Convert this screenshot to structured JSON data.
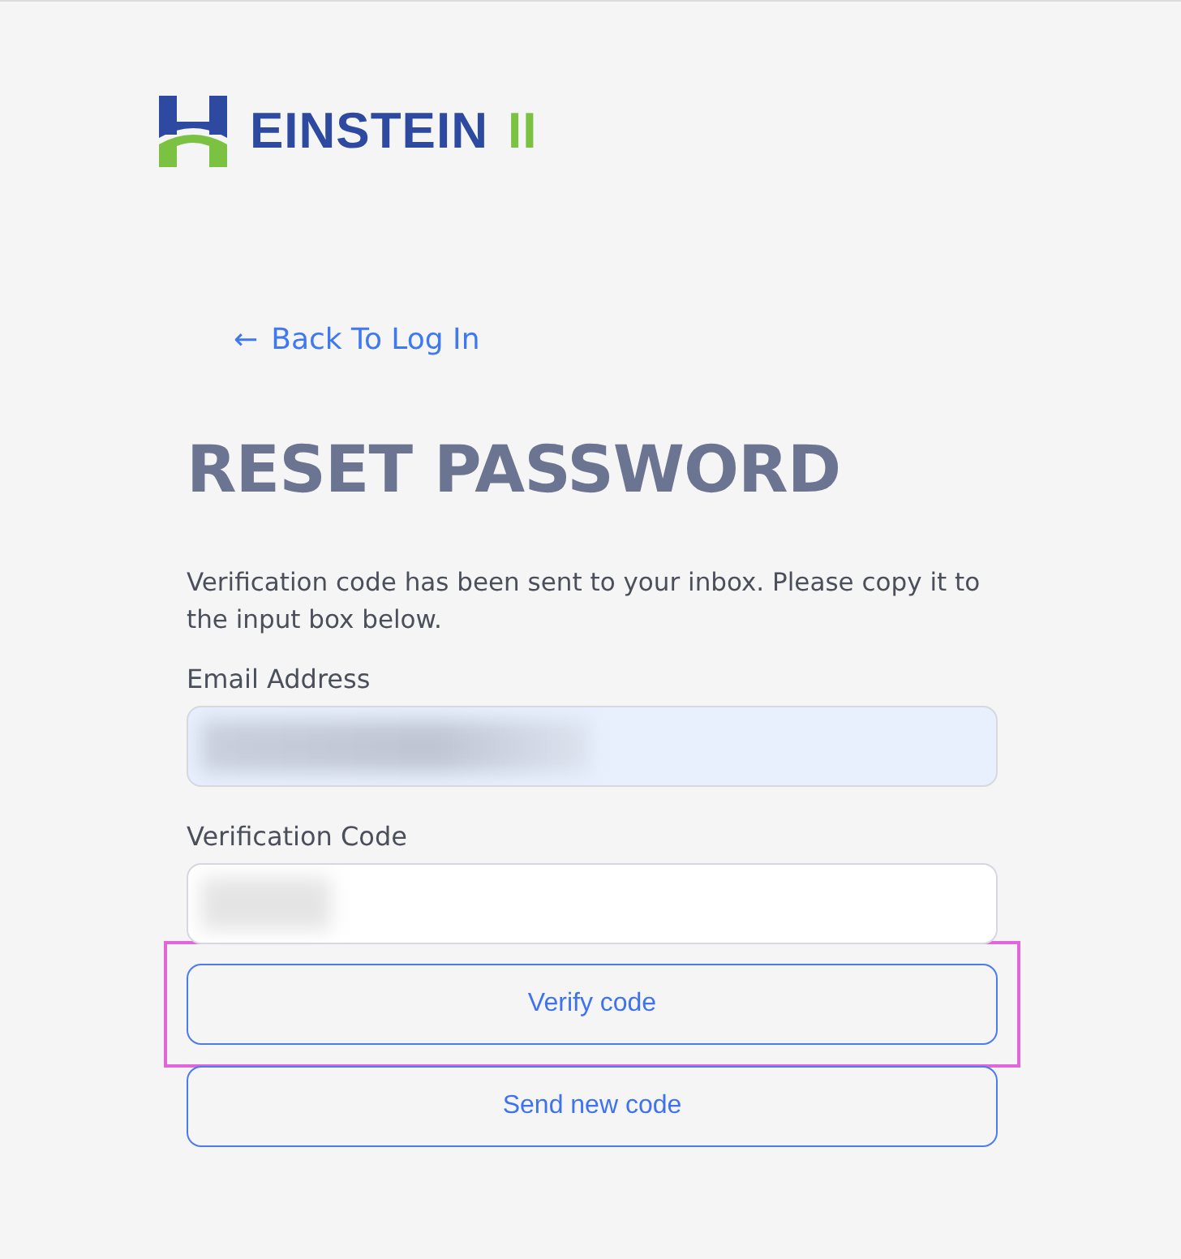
{
  "brand": {
    "name": "EINSTEIN",
    "suffix": "II"
  },
  "back_link": {
    "icon": "←",
    "label": "Back To Log In"
  },
  "title": "RESET PASSWORD",
  "message": "Verification code has been sent to your inbox. Please copy it to the input box below.",
  "fields": [
    {
      "label": "Email Address",
      "autofilled": true,
      "redacted": true
    },
    {
      "label": "Verification Code",
      "autofilled": false,
      "redacted": true
    }
  ],
  "buttons": [
    {
      "label": "Verify code",
      "highlighted": true
    },
    {
      "label": "Send new code",
      "highlighted": false
    }
  ]
}
